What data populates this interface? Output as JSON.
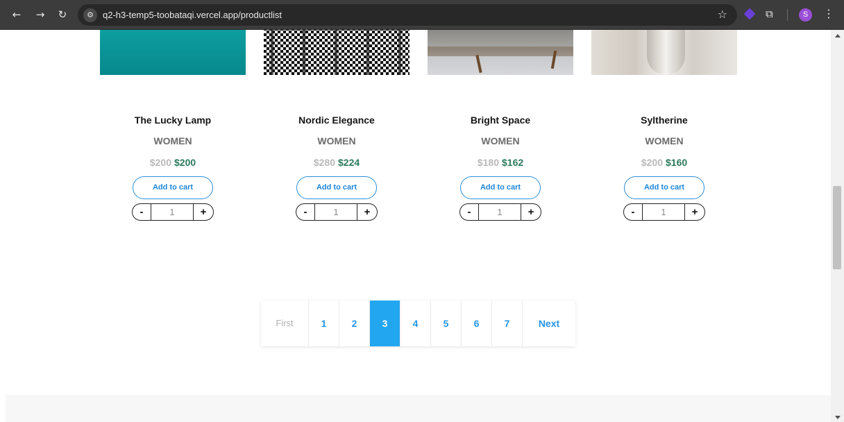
{
  "browser": {
    "url": "q2-h3-temp5-toobataqi.vercel.app/productlist",
    "profile_initial": "S"
  },
  "products": [
    {
      "name": "The Lucky Lamp",
      "category": "WOMEN",
      "old_price": "$200",
      "price": "$200",
      "add_label": "Add to cart",
      "quantity": "1",
      "minus": "-",
      "plus": "+"
    },
    {
      "name": "Nordic Elegance",
      "category": "WOMEN",
      "old_price": "$280",
      "price": "$224",
      "add_label": "Add to cart",
      "quantity": "1",
      "minus": "-",
      "plus": "+"
    },
    {
      "name": "Bright Space",
      "category": "WOMEN",
      "old_price": "$180",
      "price": "$162",
      "add_label": "Add to cart",
      "quantity": "1",
      "minus": "-",
      "plus": "+"
    },
    {
      "name": "Syltherine",
      "category": "WOMEN",
      "old_price": "$200",
      "price": "$160",
      "add_label": "Add to cart",
      "quantity": "1",
      "minus": "-",
      "plus": "+"
    }
  ],
  "pagination": {
    "first": "First",
    "pages": [
      "1",
      "2",
      "3",
      "4",
      "5",
      "6",
      "7"
    ],
    "active": "3",
    "next": "Next"
  }
}
